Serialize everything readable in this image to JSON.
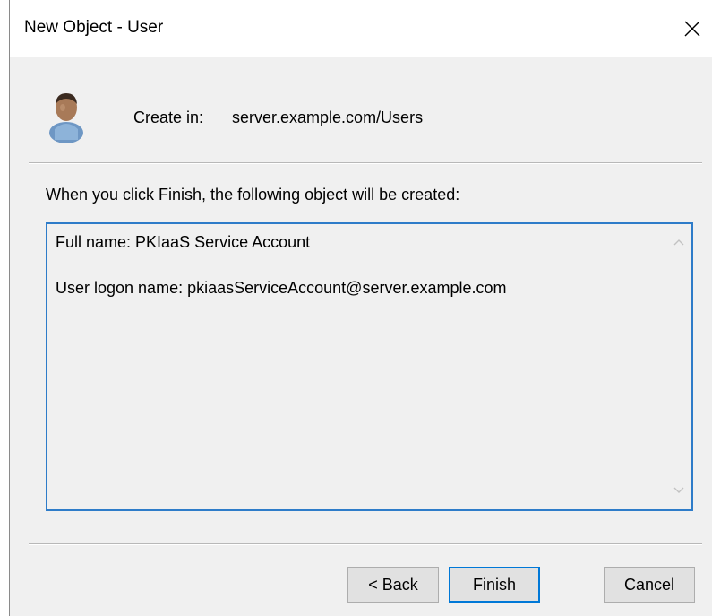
{
  "window": {
    "title": "New Object - User",
    "close_icon": "close-icon"
  },
  "header": {
    "icon": "user-icon",
    "create_in_label": "Create in:",
    "create_in_value": "server.example.com/Users"
  },
  "intro_text": "When you click Finish, the following object will be created:",
  "summary": {
    "full_name_line": "Full name: PKIaaS Service Account",
    "logon_name_line": "User logon name: pkiaasServiceAccount@server.example.com"
  },
  "buttons": {
    "back": "< Back",
    "finish": "Finish",
    "cancel": "Cancel"
  },
  "colors": {
    "focus_border": "#0078d7",
    "summary_border": "#2e7cc9",
    "dialog_bg": "#f0f0f0"
  }
}
